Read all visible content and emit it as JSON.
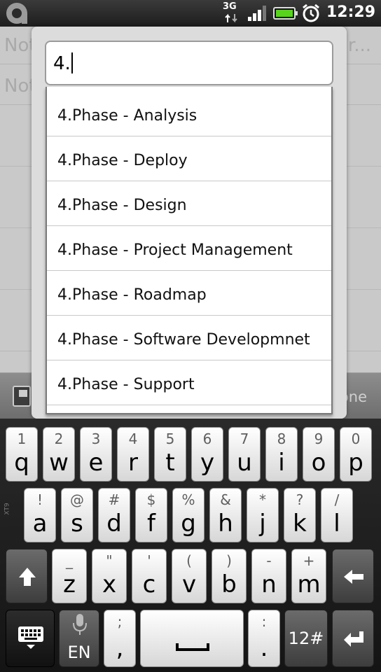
{
  "status_bar": {
    "network": "3G",
    "time": "12:29",
    "icons": [
      "app-logo-icon",
      "network-3g-icon",
      "signal-icon",
      "battery-icon",
      "alarm-icon"
    ]
  },
  "background_app": {
    "field_1": "Not",
    "field_1_right": "r...",
    "field_2": "Not",
    "done_label": "one"
  },
  "dialog": {
    "input_value": "4.",
    "suggestions": [
      "4.Phase - Analysis",
      "4.Phase - Deploy",
      "4.Phase - Design",
      "4.Phase - Project Management",
      "4.Phase - Roadmap",
      "4.Phase - Software Developmnet",
      "4.Phase - Support"
    ]
  },
  "keyboard": {
    "row1": [
      {
        "sub": "1",
        "main": "q"
      },
      {
        "sub": "2",
        "main": "w"
      },
      {
        "sub": "3",
        "main": "e"
      },
      {
        "sub": "4",
        "main": "r"
      },
      {
        "sub": "5",
        "main": "t"
      },
      {
        "sub": "6",
        "main": "y"
      },
      {
        "sub": "7",
        "main": "u"
      },
      {
        "sub": "8",
        "main": "i"
      },
      {
        "sub": "9",
        "main": "o"
      },
      {
        "sub": "0",
        "main": "p"
      }
    ],
    "row2": [
      {
        "sub": "!",
        "main": "a"
      },
      {
        "sub": "@",
        "main": "s"
      },
      {
        "sub": "#",
        "main": "d"
      },
      {
        "sub": "$",
        "main": "f"
      },
      {
        "sub": "%",
        "main": "g"
      },
      {
        "sub": "&",
        "main": "h"
      },
      {
        "sub": "*",
        "main": "j"
      },
      {
        "sub": "?",
        "main": "k"
      },
      {
        "sub": "/",
        "main": "l"
      }
    ],
    "row3": [
      {
        "sub": "_",
        "main": "z"
      },
      {
        "sub": "\"",
        "main": "x"
      },
      {
        "sub": "'",
        "main": "c"
      },
      {
        "sub": "(",
        "main": "v"
      },
      {
        "sub": ")",
        "main": "b"
      },
      {
        "sub": "-",
        "main": "n"
      },
      {
        "sub": "+",
        "main": "m"
      }
    ],
    "lang_label": "EN",
    "punct_sub": ";",
    "punct_main": ",",
    "colon_sub": ":",
    "colon_main": ".",
    "symbols_label": "12#",
    "side_label": "XT9"
  }
}
